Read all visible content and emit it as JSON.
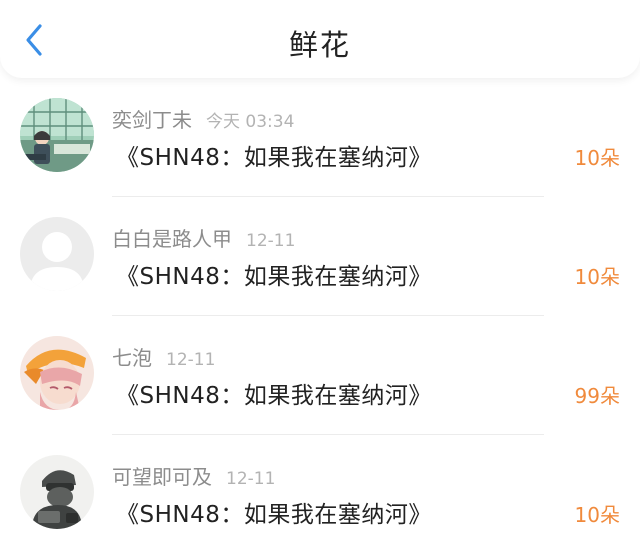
{
  "header": {
    "title": "鲜花",
    "back_icon": "chevron-left-icon",
    "accent": "#3a8ee6"
  },
  "colors": {
    "count": "#f08a3c"
  },
  "items": [
    {
      "user": "奕剑丁未",
      "time": "今天 03:34",
      "book": "《SHN48：如果我在塞纳河》",
      "count": "10朵",
      "avatar": "avatar-illustration-girl-window"
    },
    {
      "user": "白白是路人甲",
      "time": "12-11",
      "book": "《SHN48：如果我在塞纳河》",
      "count": "10朵",
      "avatar": "avatar-default-silhouette"
    },
    {
      "user": "七泡",
      "time": "12-11",
      "book": "《SHN48：如果我在塞纳河》",
      "count": "99朵",
      "avatar": "avatar-anime-girl-helmet"
    },
    {
      "user": "可望即可及",
      "time": "12-11",
      "book": "《SHN48：如果我在塞纳河》",
      "count": "10朵",
      "avatar": "avatar-soldier-helmet"
    }
  ]
}
